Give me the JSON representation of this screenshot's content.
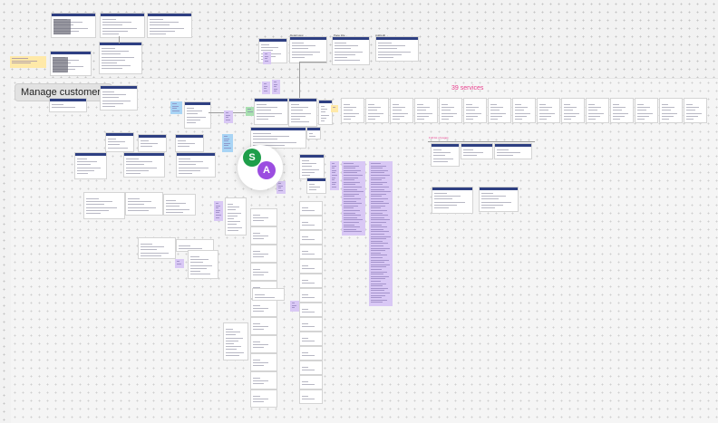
{
  "canvas": {
    "section_title": "Manage customers",
    "services_label": "39 services",
    "tiny_label_1": "Detail view",
    "tiny_label_2": "Page title",
    "tiny_label_3": "Add/edit",
    "list_label": "Full list of pages"
  },
  "collaborators": [
    {
      "initial": "S",
      "color": "#1e9e4a"
    },
    {
      "initial": "A",
      "color": "#9b4de0"
    }
  ],
  "colors": {
    "sticky_yellow": "#ffe9a8",
    "sticky_purple": "#d9c8f5",
    "sticky_blue": "#a8d4f5",
    "sticky_green": "#a8e0b0",
    "accent_pink": "#e83e8c",
    "nav_blue": "#2e3f82"
  }
}
